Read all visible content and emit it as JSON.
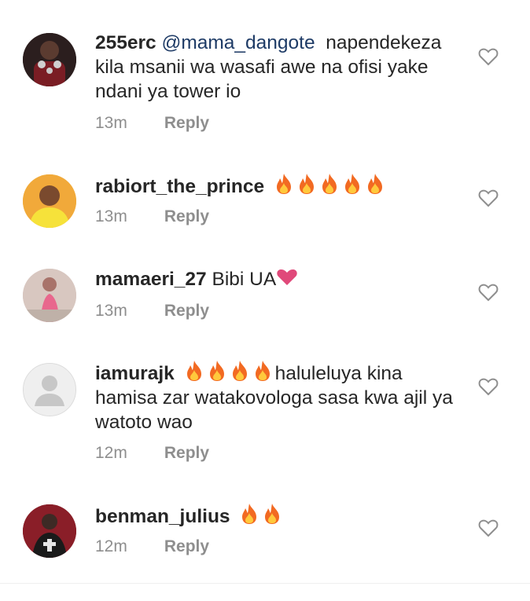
{
  "comments": [
    {
      "username": "255erc",
      "mention": "@mama_dangote",
      "text": "napendekeza kila msanii wa wasafi awe na ofisi yake ndani ya tower io",
      "time": "13m",
      "reply": "Reply",
      "emoji": "none"
    },
    {
      "username": "rabiort_the_prince",
      "text": "",
      "emoji": "fire x5",
      "time": "13m",
      "reply": "Reply"
    },
    {
      "username": "mamaeri_27",
      "text": "Bibi UA",
      "emoji": "pink heart",
      "time": "13m",
      "reply": "Reply"
    },
    {
      "username": "iamurajk",
      "text": "haluleluya kina hamisa zar watakovologa sasa kwa ajil ya watoto wao",
      "emoji": "fire x4",
      "time": "12m",
      "reply": "Reply"
    },
    {
      "username": "benman_julius",
      "text": "",
      "emoji": "fire x2",
      "time": "12m",
      "reply": "Reply"
    }
  ],
  "icons": {
    "like": "heart-outline-icon",
    "fire": "fire-emoji",
    "pink_heart": "pink-heart-emoji"
  },
  "colors": {
    "username": "#262626",
    "mention": "#1e3b66",
    "meta": "#8e8e8e",
    "fire": "#f26a22",
    "pink_heart": "#e0497a"
  }
}
